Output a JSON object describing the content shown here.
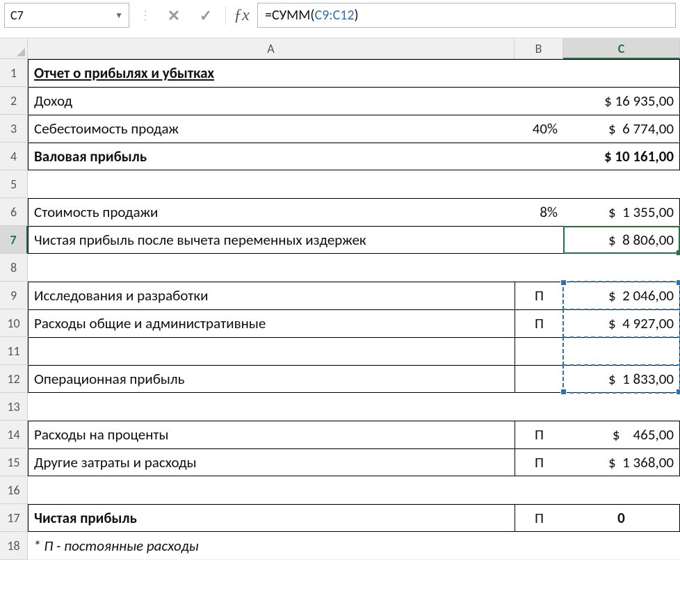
{
  "name_box": "C7",
  "formula": {
    "prefix": "=СУММ",
    "open": "(",
    "ref": "C9:C12",
    "close": ")"
  },
  "colA": "A",
  "colB": "B",
  "colC": "C",
  "rows": {
    "1": {
      "a": "Отчет о прибылях и убытках"
    },
    "2": {
      "a": "Доход",
      "c": "$ 16 935,00"
    },
    "3": {
      "a": "Себестоимость продаж",
      "b": "40%",
      "c": "$  6 774,00"
    },
    "4": {
      "a": "Валовая прибыль",
      "c": "$ 10 161,00"
    },
    "5": {},
    "6": {
      "a": "Стоимость продажи",
      "b": "8%",
      "c": "$  1 355,00"
    },
    "7": {
      "a": "Чистая прибыль после вычета переменных издержек",
      "c": "$  8 806,00"
    },
    "8": {},
    "9": {
      "a": "Исследования и разработки",
      "b": "П",
      "c": "$  2 046,00"
    },
    "10": {
      "a": "Расходы общие и административные",
      "b": "П",
      "c": "$  4 927,00"
    },
    "11": {},
    "12": {
      "a": "Операционная прибыль",
      "c": "$  1 833,00"
    },
    "13": {},
    "14": {
      "a": "Расходы на проценты",
      "b": "П",
      "c": "$    465,00"
    },
    "15": {
      "a": "Другие затраты и расходы",
      "b": "П",
      "c": "$  1 368,00"
    },
    "16": {},
    "17": {
      "a": "Чистая прибыль",
      "b": "П",
      "c": "0"
    },
    "18": {
      "a": "* П - постоянные расходы"
    }
  }
}
